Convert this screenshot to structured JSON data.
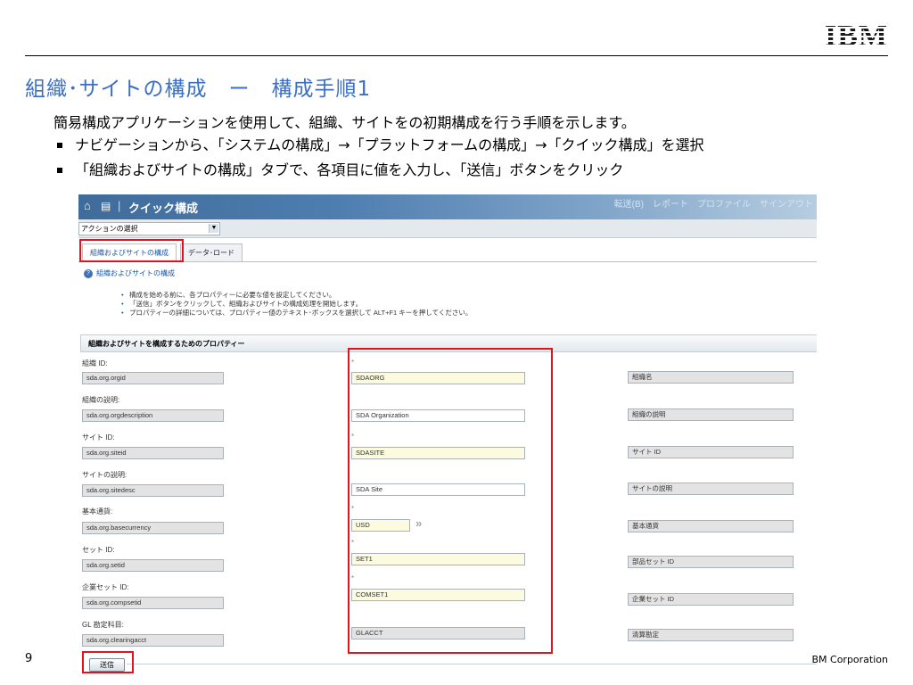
{
  "slide": {
    "logo": "IBM",
    "title": "組織･サイトの構成　ー　構成手順1",
    "intro": "簡易構成アプリケーションを使用して、組織、サイトをの初期構成を行う手順を示します。",
    "bullets": [
      "ナビゲーションから、「システムの構成」→「プラットフォームの構成」→「クイック構成」を選択",
      "「組織およびサイトの構成」タブで、各項目に値を入力し、「送信」ボタンをクリック"
    ],
    "page_number": "9",
    "copyright": "BM Corporation"
  },
  "screenshot": {
    "app_title": "クイック構成",
    "header_links": "転送(B)　レポート　プロファイル　サインアウト",
    "action_select": "アクションの選択",
    "tabs": [
      "組織およびサイトの構成",
      "データ･ロード"
    ],
    "section_title": "組織およびサイトの構成",
    "instructions": [
      "構成を始める前に、各プロパティーに必要な値を設定してください。",
      "「送信」ボタンをクリックして、組織およびサイトの構成処理を開始します。",
      "プロパティーの詳細については、プロパティー値のテキスト･ボックスを選択して ALT+F1 キーを押してください。"
    ],
    "properties_header": "組織およびサイトを構成するためのプロパティー",
    "required_mark": "*",
    "submit_label": "送信",
    "rows": [
      {
        "label": "組織 ID:",
        "property": "sda.org.orgid",
        "value": "SDAORG",
        "description": "組織名"
      },
      {
        "label": "組織の説明:",
        "property": "sda.org.orgdescription",
        "value": "SDA Organization",
        "description": "組織の説明"
      },
      {
        "label": "サイト ID:",
        "property": "sda.org.siteid",
        "value": "SDASITE",
        "description": "サイト ID"
      },
      {
        "label": "サイトの説明:",
        "property": "sda.org.sitedesc",
        "value": "SDA Site",
        "description": "サイトの説明"
      },
      {
        "label": "基本通貨:",
        "property": "sda.org.basecurrency",
        "value": "USD",
        "description": "基本通貨"
      },
      {
        "label": "セット ID:",
        "property": "sda.org.setid",
        "value": "SET1",
        "description": "部品セット ID"
      },
      {
        "label": "企業セット ID:",
        "property": "sda.org.compsetid",
        "value": "COMSET1",
        "description": "企業セット ID"
      },
      {
        "label": "GL 勘定科目:",
        "property": "sda.org.clearingacct",
        "value": "GLACCT",
        "description": "清算勘定"
      }
    ]
  },
  "colors": {
    "title": "#3a6fc4",
    "highlight_border": "#e0141e",
    "header_gradient_start": "#3f6c9a",
    "required_field": "#fcfbe0"
  }
}
